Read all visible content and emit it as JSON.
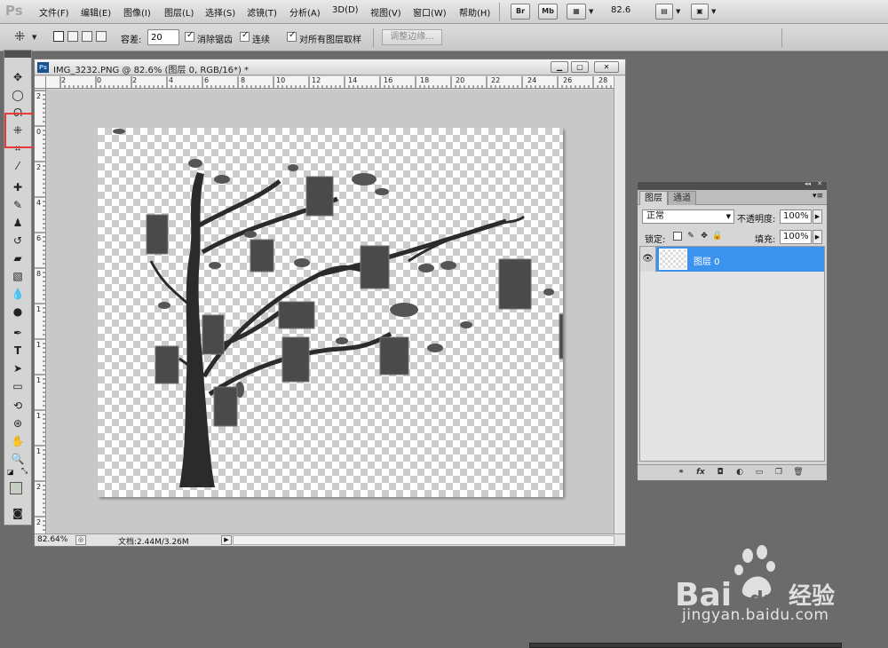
{
  "app": {
    "logo": "Ps"
  },
  "menu": {
    "items": [
      "文件(F)",
      "编辑(E)",
      "图像(I)",
      "图层(L)",
      "选择(S)",
      "滤镜(T)",
      "分析(A)",
      "3D(D)",
      "视图(V)",
      "窗口(W)",
      "帮助(H)"
    ],
    "bridge_label": "Br",
    "mini_bridge_label": "Mb",
    "zoom_value": "82.6"
  },
  "options": {
    "tolerance_label": "容差:",
    "tolerance_value": "20",
    "anti_alias_label": "消除锯齿",
    "contiguous_label": "连续",
    "sample_all_layers_label": "对所有图层取样",
    "refine_edge_label": "调整边缘..."
  },
  "document": {
    "title": "IMG_3232.PNG @ 82.6% (图层 0, RGB/16*) *",
    "ruler_h_labels": [
      "2",
      "0",
      "2",
      "4",
      "6",
      "8",
      "10",
      "12",
      "14",
      "16",
      "18",
      "20",
      "22",
      "24",
      "26",
      "28"
    ],
    "ruler_v_labels": [
      "2",
      "0",
      "2",
      "4",
      "6",
      "8",
      "1",
      "1",
      "1",
      "1",
      "1",
      "2",
      "2"
    ],
    "status_zoom": "82.64%",
    "status_doc": "文档:2.44M/3.26M"
  },
  "layers_panel": {
    "tab_layers": "图层",
    "tab_channels": "通道",
    "blend_mode": "正常",
    "opacity_label": "不透明度:",
    "opacity_value": "100%",
    "lock_label": "锁定:",
    "fill_label": "填充:",
    "fill_value": "100%",
    "layer_name": "图层 0"
  },
  "watermark": {
    "url_text": "jingyan.baidu.com"
  },
  "colors": {
    "highlight": "#e53a3a",
    "layer_selected": "#3c93ee",
    "foreground_swatch": "#c6cdc3",
    "background_swatch": "#ffffff"
  }
}
